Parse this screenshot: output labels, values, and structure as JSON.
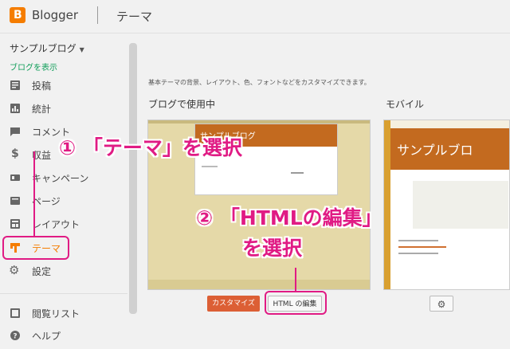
{
  "header": {
    "brand": "Blogger",
    "page_title": "テーマ",
    "logo_letter": "B"
  },
  "sidebar": {
    "blog_name": "サンプルブログ",
    "view_blog": "ブログを表示",
    "items": [
      {
        "label": "投稿",
        "icon": "posts-icon"
      },
      {
        "label": "統計",
        "icon": "stats-icon"
      },
      {
        "label": "コメント",
        "icon": "comments-icon"
      },
      {
        "label": "収益",
        "icon": "earnings-icon"
      },
      {
        "label": "キャンペーン",
        "icon": "campaigns-icon"
      },
      {
        "label": "ページ",
        "icon": "pages-icon"
      },
      {
        "label": "レイアウト",
        "icon": "layout-icon"
      },
      {
        "label": "テーマ",
        "icon": "theme-icon"
      },
      {
        "label": "設定",
        "icon": "settings-icon"
      },
      {
        "label": "閲覧リスト",
        "icon": "reading-list-icon"
      },
      {
        "label": "ヘルプ",
        "icon": "help-icon"
      }
    ]
  },
  "main": {
    "description": "基本テーマの背景、レイアウト、色、フォントなどをカスタマイズできます。",
    "desktop_label": "ブログで使用中",
    "mobile_label": "モバイル",
    "desktop_preview_title": "サンプルブログ",
    "mobile_preview_title": "サンプルブロ",
    "customize_button": "カスタマイズ",
    "edit_html_button": "HTML の編集"
  },
  "annotations": {
    "step1": "① 「テーマ」を選択",
    "step2_line1": "② 「HTMLの編集」",
    "step2_line2": "を選択"
  },
  "colors": {
    "accent": "#f57d00",
    "annotation": "#e01b84",
    "customize_bg": "#dc5f35"
  }
}
